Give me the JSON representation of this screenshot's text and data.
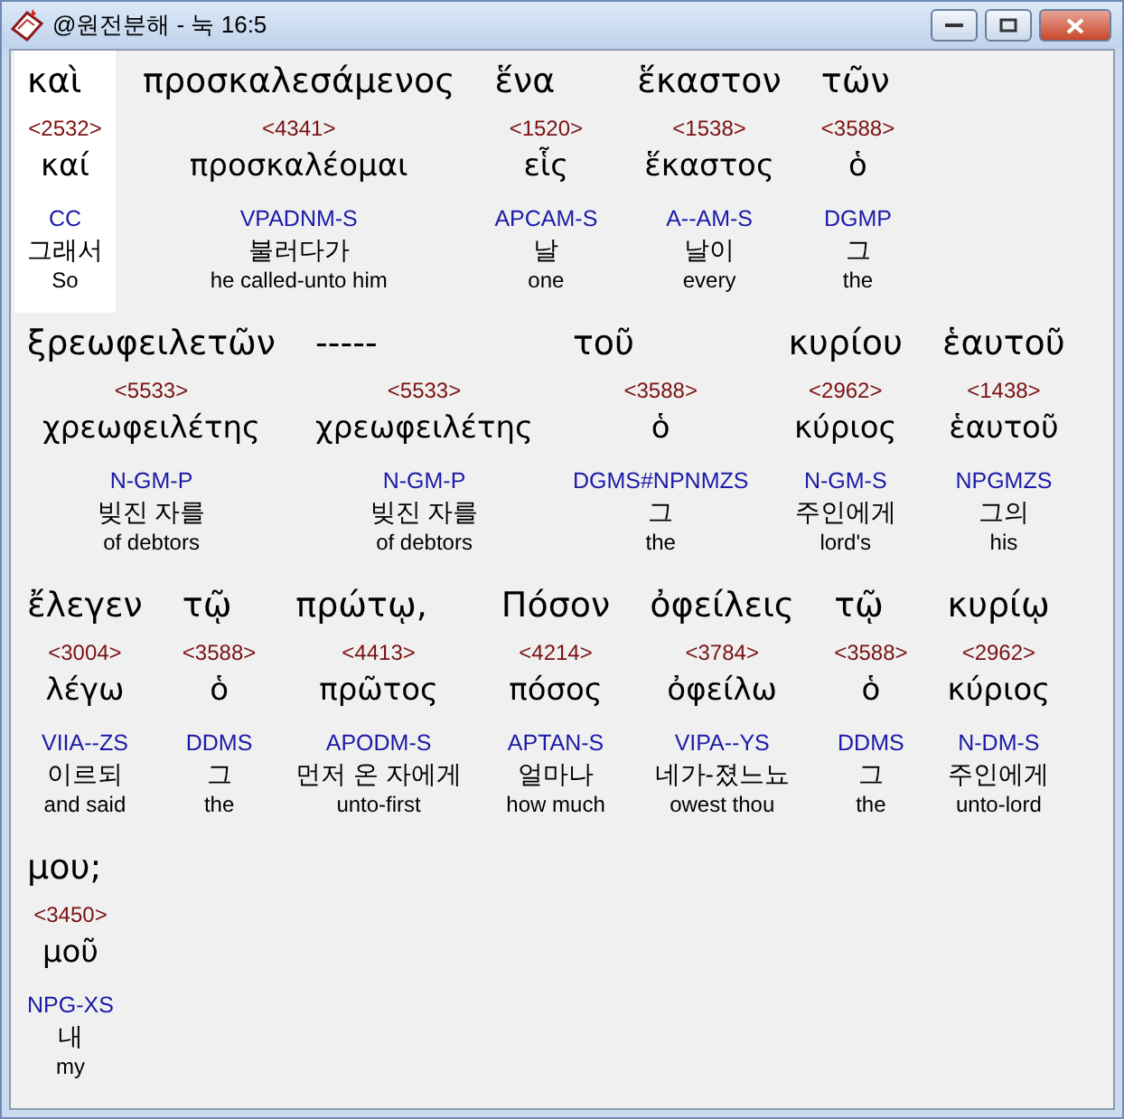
{
  "window": {
    "title": "@원전분해 - 눅 16:5"
  },
  "lines": [
    {
      "words": [
        {
          "greek": "καὶ",
          "strong": "<2532>",
          "lemma": "καί",
          "morph": "CC",
          "korean": "그래서",
          "english": "So",
          "selected": true
        },
        {
          "greek": "προσκαλεσάμενος",
          "strong": "<4341>",
          "lemma": "προσκαλέομαι",
          "morph": "VPADNM-S",
          "korean": "불러다가",
          "english": "he called-unto him",
          "selected": false
        },
        {
          "greek": "ἕνα",
          "strong": "<1520>",
          "lemma": "εἷς",
          "morph": "APCAM-S",
          "korean": "날",
          "english": "one",
          "selected": false
        },
        {
          "greek": "ἕκαστον",
          "strong": "<1538>",
          "lemma": "ἕκαστος",
          "morph": "A--AM-S",
          "korean": "날이",
          "english": "every",
          "selected": false
        },
        {
          "greek": "τῶν",
          "strong": "<3588>",
          "lemma": "ὁ",
          "morph": "DGMP",
          "korean": "그",
          "english": "the",
          "selected": false
        }
      ]
    },
    {
      "words": [
        {
          "greek": "ξρεωφειλετῶν",
          "strong": "<5533>",
          "lemma": "χρεωφειλέτης",
          "morph": "N-GM-P",
          "korean": "빚진 자를",
          "english": "of debtors",
          "selected": false
        },
        {
          "greek": "-----",
          "strong": "<5533>",
          "lemma": "χρεωφειλέτης",
          "morph": "N-GM-P",
          "korean": "빚진 자를",
          "english": "of debtors",
          "selected": false
        },
        {
          "greek": "τοῦ",
          "strong": "<3588>",
          "lemma": "ὁ",
          "morph": "DGMS#NPNMZS",
          "korean": "그",
          "english": "the",
          "selected": false
        },
        {
          "greek": "κυρίου",
          "strong": "<2962>",
          "lemma": "κύριος",
          "morph": "N-GM-S",
          "korean": "주인에게",
          "english": "lord's",
          "selected": false
        },
        {
          "greek": "ἑαυτοῦ",
          "strong": "<1438>",
          "lemma": "ἑαυτοῦ",
          "morph": "NPGMZS",
          "korean": "그의",
          "english": "his",
          "selected": false
        }
      ]
    },
    {
      "words": [
        {
          "greek": "ἔλεγεν",
          "strong": "<3004>",
          "lemma": "λέγω",
          "morph": "VIIA--ZS",
          "korean": "이르되",
          "english": "and said",
          "selected": false
        },
        {
          "greek": "τῷ",
          "strong": "<3588>",
          "lemma": "ὁ",
          "morph": "DDMS",
          "korean": "그",
          "english": "the",
          "selected": false
        },
        {
          "greek": "πρώτῳ,",
          "strong": "<4413>",
          "lemma": "πρῶτος",
          "morph": "APODM-S",
          "korean": "먼저 온 자에게",
          "english": "unto-first",
          "selected": false
        },
        {
          "greek": "Πόσον",
          "strong": "<4214>",
          "lemma": "πόσος",
          "morph": "APTAN-S",
          "korean": "얼마나",
          "english": "how much",
          "selected": false
        },
        {
          "greek": "ὀφείλεις",
          "strong": "<3784>",
          "lemma": "ὀφείλω",
          "morph": "VIPA--YS",
          "korean": "네가-졌느뇨",
          "english": "owest thou",
          "selected": false
        },
        {
          "greek": "τῷ",
          "strong": "<3588>",
          "lemma": "ὁ",
          "morph": "DDMS",
          "korean": "그",
          "english": "the",
          "selected": false
        },
        {
          "greek": "κυρίῳ",
          "strong": "<2962>",
          "lemma": "κύριος",
          "morph": "N-DM-S",
          "korean": "주인에게",
          "english": "unto-lord",
          "selected": false
        }
      ]
    },
    {
      "words": [
        {
          "greek": "μου;",
          "strong": "<3450>",
          "lemma": "μοῦ",
          "morph": "NPG-XS",
          "korean": "내",
          "english": "my",
          "selected": false
        }
      ]
    }
  ]
}
